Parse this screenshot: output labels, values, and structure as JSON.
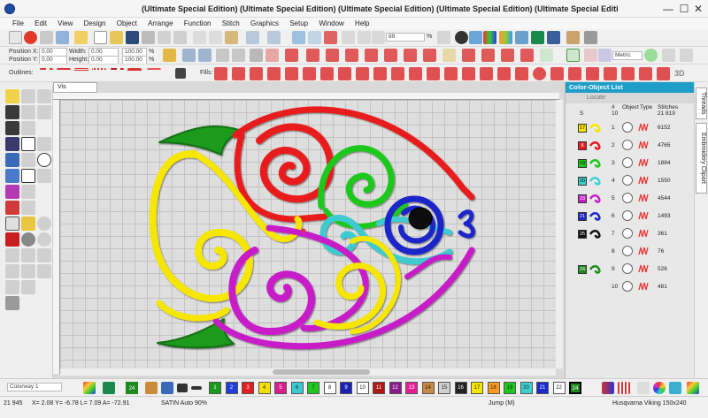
{
  "window": {
    "title": "(Ultimate Special Edition) (Ultimate Special Edition) (Ultimate Special Edition) (Ultimate Special Edition) (Ultimate Special Editi",
    "min_glyph": "—",
    "max_glyph": "☐",
    "close_glyph": "✕"
  },
  "menu": [
    "File",
    "Edit",
    "View",
    "Design",
    "Object",
    "Arrange",
    "Function",
    "Stitch",
    "Graphics",
    "Setup",
    "Window",
    "Help"
  ],
  "toolbar": {
    "zoom_value": "89",
    "zoom_unit": "%",
    "units_value": "Metric"
  },
  "position_bar": {
    "pos_x_label": "Position X:",
    "pos_y_label": "Position Y:",
    "pos_x_value": "0.00",
    "pos_y_value": "0.00",
    "width_label": "Width:",
    "height_label": "Height:",
    "width_value": "0.00",
    "height_value": "0.00",
    "wpct": "100.00",
    "hpct": "100.00",
    "wunit": "mm",
    "hunit": "mm",
    "pct": "%"
  },
  "outline_bar": {
    "outlines_label": "Outlines:",
    "fills_label": "Fills:",
    "three_d": "3D"
  },
  "document_tab": "Vis",
  "panel": {
    "title": "Color-Object List",
    "locate_label": "Locate",
    "head": {
      "hash": "#",
      "object": "Object",
      "type": "Type",
      "stitches": "Stitches"
    },
    "summary": {
      "s_num": "S",
      "count": "10",
      "stitches": "21 819"
    },
    "rows": [
      {
        "color": "17",
        "swatch": "#f6e600",
        "num": "1",
        "stitches": "6152"
      },
      {
        "color": "8",
        "swatch": "#e81c1c",
        "num": "2",
        "stitches": "4765"
      },
      {
        "color": "19",
        "swatch": "#1ec81e",
        "num": "3",
        "stitches": "1884"
      },
      {
        "color": "20",
        "swatch": "#3cd0d0",
        "num": "4",
        "stitches": "1550"
      },
      {
        "color": "23",
        "swatch": "#c81ec8",
        "num": "5",
        "stitches": "4544"
      },
      {
        "color": "21",
        "swatch": "#1a28c8",
        "num": "6",
        "stitches": "1493"
      },
      {
        "color": "25",
        "swatch": "#111111",
        "num": "7",
        "stitches": "361"
      },
      {
        "color": "",
        "swatch": "",
        "num": "8",
        "stitches": "76"
      },
      {
        "color": "24",
        "swatch": "#1e8a1e",
        "num": "9",
        "stitches": "526"
      },
      {
        "color": "",
        "swatch": "",
        "num": "10",
        "stitches": "481"
      }
    ]
  },
  "side_tabs": {
    "threads": "Threads",
    "clipart": "Embroidery Clipart"
  },
  "colorway": {
    "value": "Colorway 1",
    "current_color": "24",
    "swatches": [
      {
        "n": "1",
        "c": "#1a9a1a"
      },
      {
        "n": "2",
        "c": "#1f3fd6"
      },
      {
        "n": "3",
        "c": "#e41e1e"
      },
      {
        "n": "4",
        "c": "#f2e200"
      },
      {
        "n": "5",
        "c": "#d91c8c"
      },
      {
        "n": "6",
        "c": "#3ccad0"
      },
      {
        "n": "7",
        "c": "#1ec81e"
      },
      {
        "n": "8",
        "c": "#ffffff"
      },
      {
        "n": "9",
        "c": "#1a22b0"
      },
      {
        "n": "10",
        "c": "#ffffff"
      },
      {
        "n": "11",
        "c": "#b01616"
      },
      {
        "n": "12",
        "c": "#8a1a8a"
      },
      {
        "n": "13",
        "c": "#e81e96"
      },
      {
        "n": "14",
        "c": "#c88a46"
      },
      {
        "n": "15",
        "c": "#d0d0d0"
      },
      {
        "n": "16",
        "c": "#222222"
      },
      {
        "n": "17",
        "c": "#f6e600"
      },
      {
        "n": "18",
        "c": "#ff9a1e"
      },
      {
        "n": "19",
        "c": "#1ec81e"
      },
      {
        "n": "20",
        "c": "#3cd0d0"
      },
      {
        "n": "21",
        "c": "#1a28c8"
      },
      {
        "n": "22",
        "c": "#ffffff"
      },
      {
        "n": "24",
        "c": "#1e8a1e"
      }
    ]
  },
  "status": {
    "stitches": "21 945",
    "coords": "X= 2.08 Y= -6.78 L= 7.09 A= -72.91",
    "stitch_type": "SATIN Auto 90%",
    "jump": "Jump (M)",
    "hoop": "Husqvarna Viking 150x240"
  }
}
